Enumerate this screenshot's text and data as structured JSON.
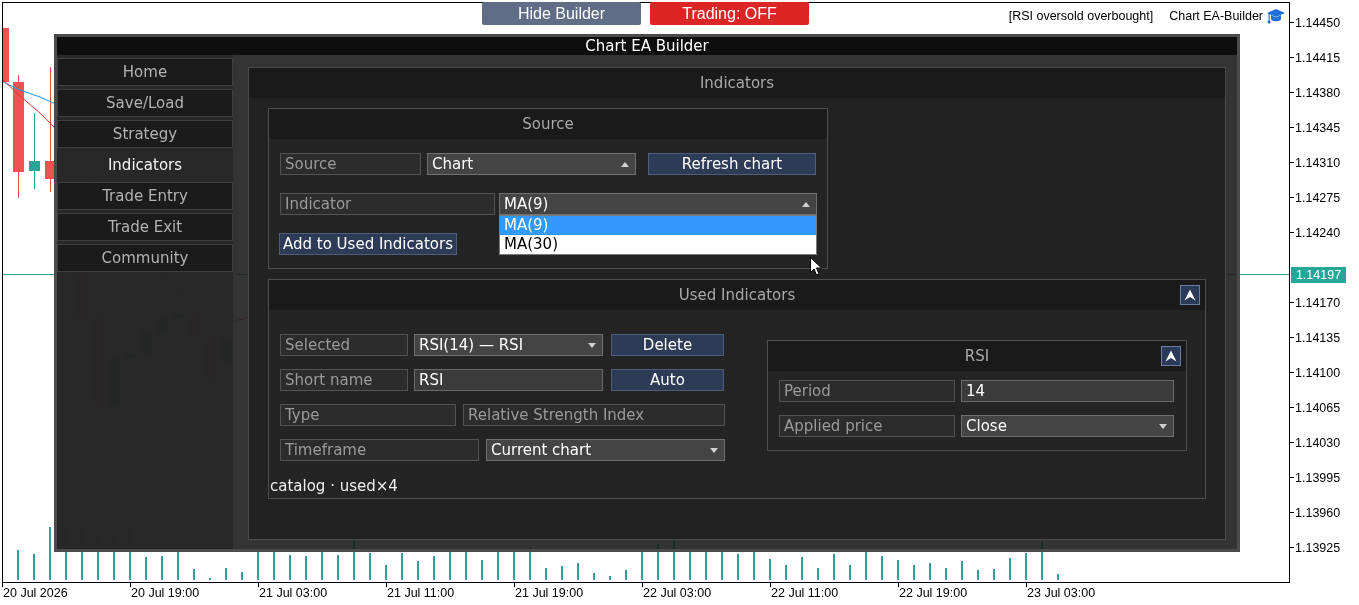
{
  "top_bar": {
    "builder_toggle": {
      "label": "Hide Builder"
    },
    "trading_toggle": {
      "label": "Trading: OFF",
      "on": false
    },
    "strategy_name": "[RSI oversold overbought]",
    "brand": "Chart EA-Builder"
  },
  "price_axis": {
    "ticks_above": [
      "1.14450",
      "1.14415",
      "1.14380",
      "1.14345",
      "1.14310",
      "1.14275",
      "1.14240"
    ],
    "current_price": "1.14197",
    "ticks_below": [
      "1.14170",
      "1.14135",
      "1.14100",
      "1.14065",
      "1.14030",
      "1.13995",
      "1.13960",
      "1.13925"
    ]
  },
  "time_axis": {
    "labels": [
      "20 Jul 2026",
      "20 Jul 19:00",
      "21 Jul 03:00",
      "21 Jul 11:00",
      "21 Jul 19:00",
      "22 Jul 03:00",
      "22 Jul 11:00",
      "22 Jul 19:00",
      "23 Jul 03:00"
    ]
  },
  "builder": {
    "title": "Chart EA Builder",
    "nav": [
      {
        "label": "Home",
        "selected": false
      },
      {
        "label": "Save/Load",
        "selected": false
      },
      {
        "label": "Strategy",
        "selected": false
      },
      {
        "label": "Indicators",
        "selected": true
      },
      {
        "label": "Trade Entry",
        "selected": false
      },
      {
        "label": "Trade Exit",
        "selected": false
      },
      {
        "label": "Community",
        "selected": false
      }
    ],
    "page": {
      "title": "Indicators",
      "source_panel": {
        "title": "Source",
        "fields": [
          {
            "kind": "dropdown",
            "label": "Source",
            "value": "Chart",
            "caret_up": true,
            "expanded": false,
            "button": "Refresh chart"
          },
          {
            "kind": "dropdown",
            "label": "Indicator",
            "value": "MA(9)",
            "caret_up": true,
            "expanded": true,
            "options": [
              {
                "label": "MA(9)",
                "selected": true
              },
              {
                "label": "MA(30)",
                "selected": false
              }
            ]
          }
        ],
        "add_button": "Add to Used Indicators"
      },
      "used_panel": {
        "title": "Used Indicators",
        "fields": [
          {
            "kind": "dropdown",
            "label": "Selected",
            "value": "RSI(14) — RSI",
            "caret_up": false,
            "button": "Delete"
          },
          {
            "kind": "input",
            "label": "Short name",
            "value": "RSI",
            "button": "Auto"
          },
          {
            "kind": "readonly",
            "label": "Type",
            "value": "Relative Strength Index"
          },
          {
            "kind": "dropdown",
            "label": "Timeframe",
            "value": "Current chart",
            "caret_up": false
          }
        ],
        "params_panel": {
          "title": "RSI",
          "fields": [
            {
              "kind": "input",
              "label": "Period",
              "value": "14"
            },
            {
              "kind": "dropdown",
              "label": "Applied price",
              "value": "Close",
              "caret_up": false
            }
          ]
        },
        "status": "catalog · used×4"
      }
    }
  }
}
